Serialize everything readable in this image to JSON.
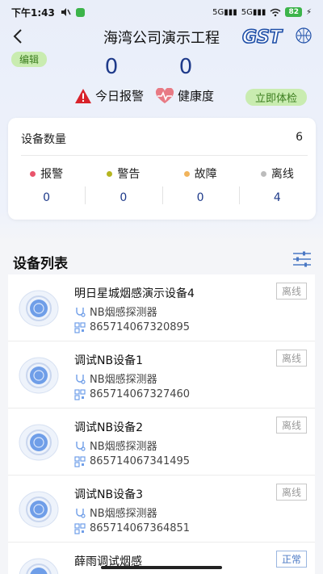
{
  "status_bar": {
    "time": "下午1:43",
    "signal1": "5G",
    "signal2": "5G",
    "battery": "82"
  },
  "header": {
    "title": "海湾公司演示工程",
    "logo": "GST"
  },
  "edit_label": "编辑",
  "today": {
    "alarm_count": "0",
    "health_count": "0",
    "alarm_label": "今日报警",
    "health_label": "健康度",
    "check_label": "立即体检"
  },
  "summary": {
    "label": "设备数量",
    "total": "6",
    "stats": [
      {
        "label": "报警",
        "value": "0",
        "color": "#e9546b"
      },
      {
        "label": "警告",
        "value": "0",
        "color": "#b5b520"
      },
      {
        "label": "故障",
        "value": "0",
        "color": "#f1b45c"
      },
      {
        "label": "离线",
        "value": "4",
        "color": "#bcbcbc"
      }
    ]
  },
  "list": {
    "title": "设备列表",
    "devices": [
      {
        "name": "明日星城烟感演示设备4",
        "type": "NB烟感探测器",
        "sn": "865714067320895",
        "status": "离线"
      },
      {
        "name": "调试NB设备1",
        "type": "NB烟感探测器",
        "sn": "865714067327460",
        "status": "离线"
      },
      {
        "name": "调试NB设备2",
        "type": "NB烟感探测器",
        "sn": "865714067341495",
        "status": "离线"
      },
      {
        "name": "调试NB设备3",
        "type": "NB烟感探测器",
        "sn": "865714067364851",
        "status": "离线"
      },
      {
        "name": "薛雨调试烟感",
        "type": "",
        "sn": "",
        "status": "正常"
      }
    ]
  }
}
